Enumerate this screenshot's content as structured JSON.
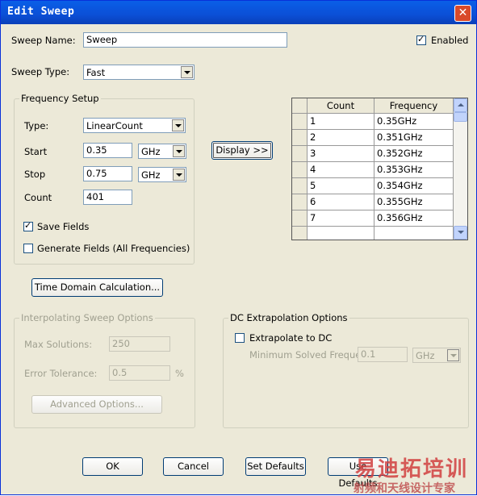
{
  "window": {
    "title": "Edit Sweep",
    "close_glyph": "✕"
  },
  "sweep_name": {
    "label": "Sweep Name:",
    "value": "Sweep"
  },
  "enabled": {
    "label": "Enabled",
    "checked": true
  },
  "sweep_type": {
    "label": "Sweep Type:",
    "value": "Fast"
  },
  "frequency_setup": {
    "title": "Frequency Setup",
    "type_label": "Type:",
    "type_value": "LinearCount",
    "start_label": "Start",
    "start_value": "0.35",
    "start_unit": "GHz",
    "stop_label": "Stop",
    "stop_value": "0.75",
    "stop_unit": "GHz",
    "count_label": "Count",
    "count_value": "401",
    "save_fields": {
      "label": "Save Fields",
      "checked": true
    },
    "generate_fields": {
      "label": "Generate Fields (All Frequencies)",
      "checked": false
    }
  },
  "display_button": "Display >>",
  "table": {
    "headers": [
      "Count",
      "Frequency"
    ],
    "rows": [
      [
        "1",
        "0.35GHz"
      ],
      [
        "2",
        "0.351GHz"
      ],
      [
        "3",
        "0.352GHz"
      ],
      [
        "4",
        "0.353GHz"
      ],
      [
        "5",
        "0.354GHz"
      ],
      [
        "6",
        "0.355GHz"
      ],
      [
        "7",
        "0.356GHz"
      ],
      [
        "",
        ""
      ]
    ]
  },
  "time_domain_button": "Time Domain Calculation...",
  "interpolating": {
    "title": "Interpolating Sweep Options",
    "max_solutions_label": "Max Solutions:",
    "max_solutions_value": "250",
    "error_tolerance_label": "Error Tolerance:",
    "error_tolerance_value": "0.5",
    "percent": "%",
    "advanced_button": "Advanced Options..."
  },
  "dc_extrapolation": {
    "title": "DC Extrapolation Options",
    "extrapolate_label": "Extrapolate to DC",
    "extrapolate_checked": false,
    "min_freq_label": "Minimum Solved Frequency",
    "min_freq_value": "0.1",
    "min_freq_unit": "GHz"
  },
  "buttons": {
    "ok": "OK",
    "cancel": "Cancel",
    "set_defaults": "Set Defaults",
    "use_defaults": "Use Defaults"
  },
  "watermark": {
    "line1": "易迪拓培训",
    "line2": "射频和天线设计专家"
  }
}
